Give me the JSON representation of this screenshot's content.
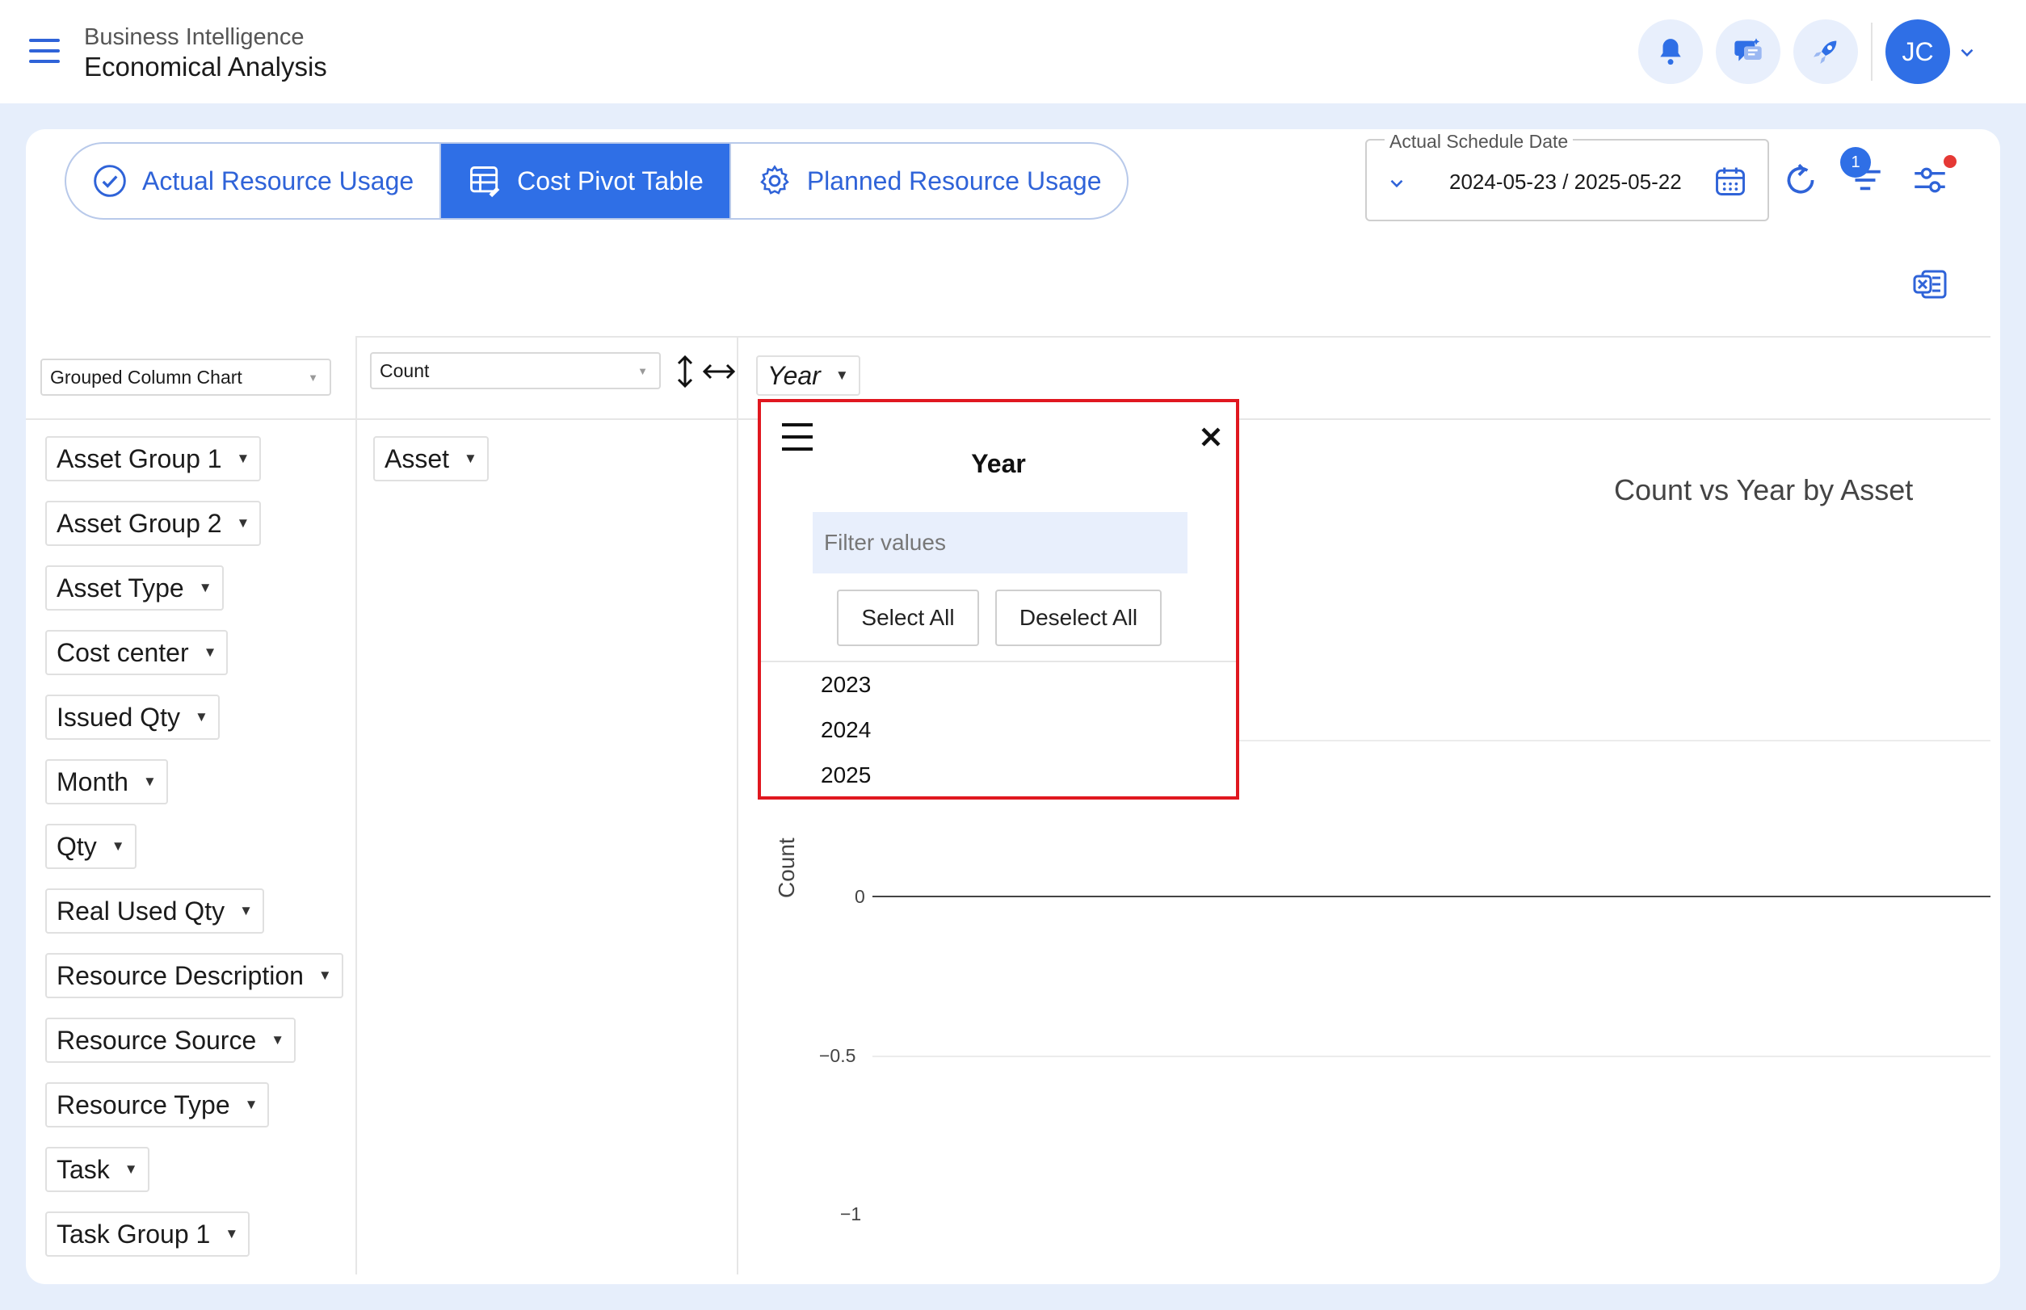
{
  "header": {
    "app_subtitle": "Business Intelligence",
    "app_title": "Economical Analysis",
    "avatar_initials": "JC"
  },
  "tabs": [
    {
      "label": "Actual Resource Usage",
      "icon": "check-circle-icon",
      "active": false
    },
    {
      "label": "Cost Pivot Table",
      "icon": "pivot-table-icon",
      "active": true
    },
    {
      "label": "Planned Resource Usage",
      "icon": "gear-icon",
      "active": false
    }
  ],
  "date_filter": {
    "legend": "Actual Schedule Date",
    "value": "2024-05-23 / 2025-05-22"
  },
  "filter_badge": "1",
  "pivot": {
    "renderer": "Grouped Column Chart",
    "aggregator": "Count",
    "col_attribute": "Year",
    "row_attribute": "Asset",
    "unused_attributes": [
      "Asset Group 1",
      "Asset Group 2",
      "Asset Type",
      "Cost center",
      "Issued Qty",
      "Month",
      "Qty",
      "Real Used Qty",
      "Resource Description",
      "Resource Source",
      "Resource Type",
      "Task",
      "Task Group 1"
    ]
  },
  "filter_popup": {
    "title": "Year",
    "placeholder": "Filter values",
    "select_all": "Select All",
    "deselect_all": "Deselect All",
    "values": [
      "2023",
      "2024",
      "2025"
    ]
  },
  "chart_data": {
    "type": "bar",
    "title": "Count vs Year by Asset",
    "ylabel": "Count",
    "xlabel": "",
    "yticks": [
      "0",
      "−0.5",
      "−1"
    ],
    "categories": [],
    "values": []
  },
  "colors": {
    "accent": "#2f6fe6",
    "highlight_border": "#e0171f",
    "background": "#e6eefb"
  }
}
